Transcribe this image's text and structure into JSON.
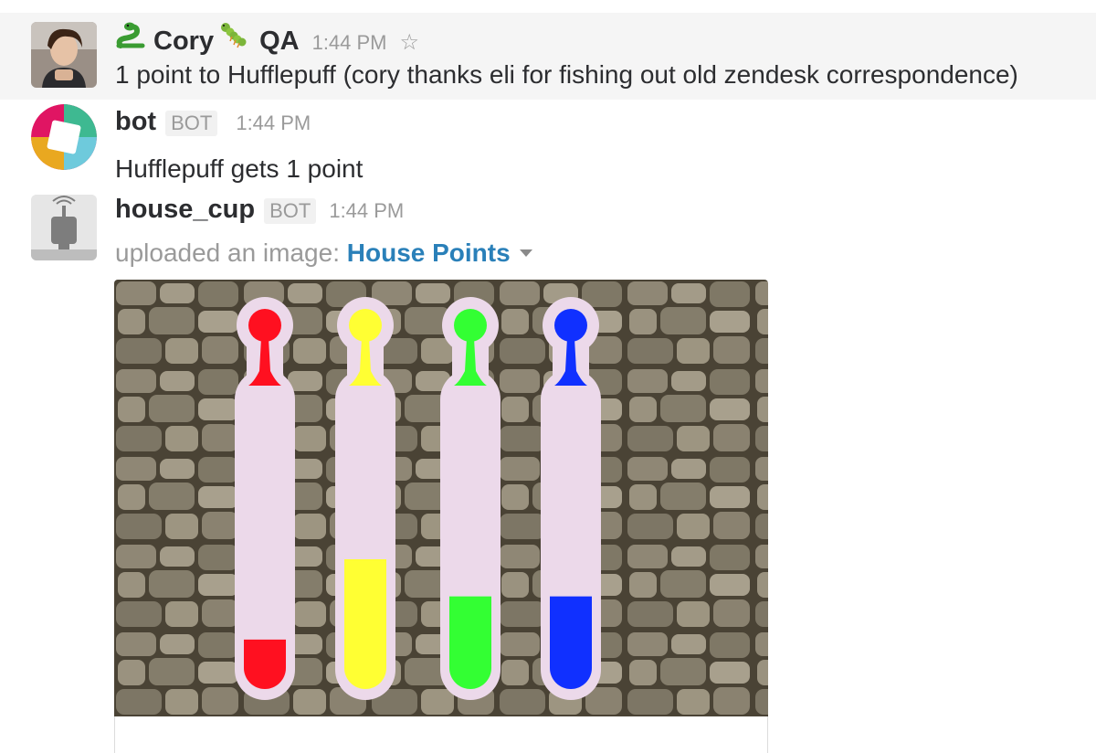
{
  "messages": [
    {
      "username": "Cory",
      "status_label": "QA",
      "time": "1:44 PM",
      "text": "1 point to Hufflepuff (cory thanks eli for fishing out old zendesk correspondence)",
      "star_icon": "star-outline-icon",
      "emoji_left": "snake-icon",
      "emoji_right": "caterpillar-icon"
    },
    {
      "username": "bot",
      "badge": "BOT",
      "time": "1:44 PM",
      "text": "Hufflepuff gets 1 point"
    },
    {
      "username": "house_cup",
      "badge": "BOT",
      "time": "1:44 PM",
      "upload_prefix": "uploaded an image:",
      "upload_title": "House Points"
    }
  ],
  "house_points_image": {
    "background": "stone-wall",
    "tube_color": "#ecd9ea",
    "houses": [
      {
        "color": "#ff1020",
        "fill_fraction": 0.16
      },
      {
        "color": "#ffff33",
        "fill_fraction": 0.42
      },
      {
        "color": "#33ff33",
        "fill_fraction": 0.3
      },
      {
        "color": "#1030ff",
        "fill_fraction": 0.3
      }
    ]
  }
}
